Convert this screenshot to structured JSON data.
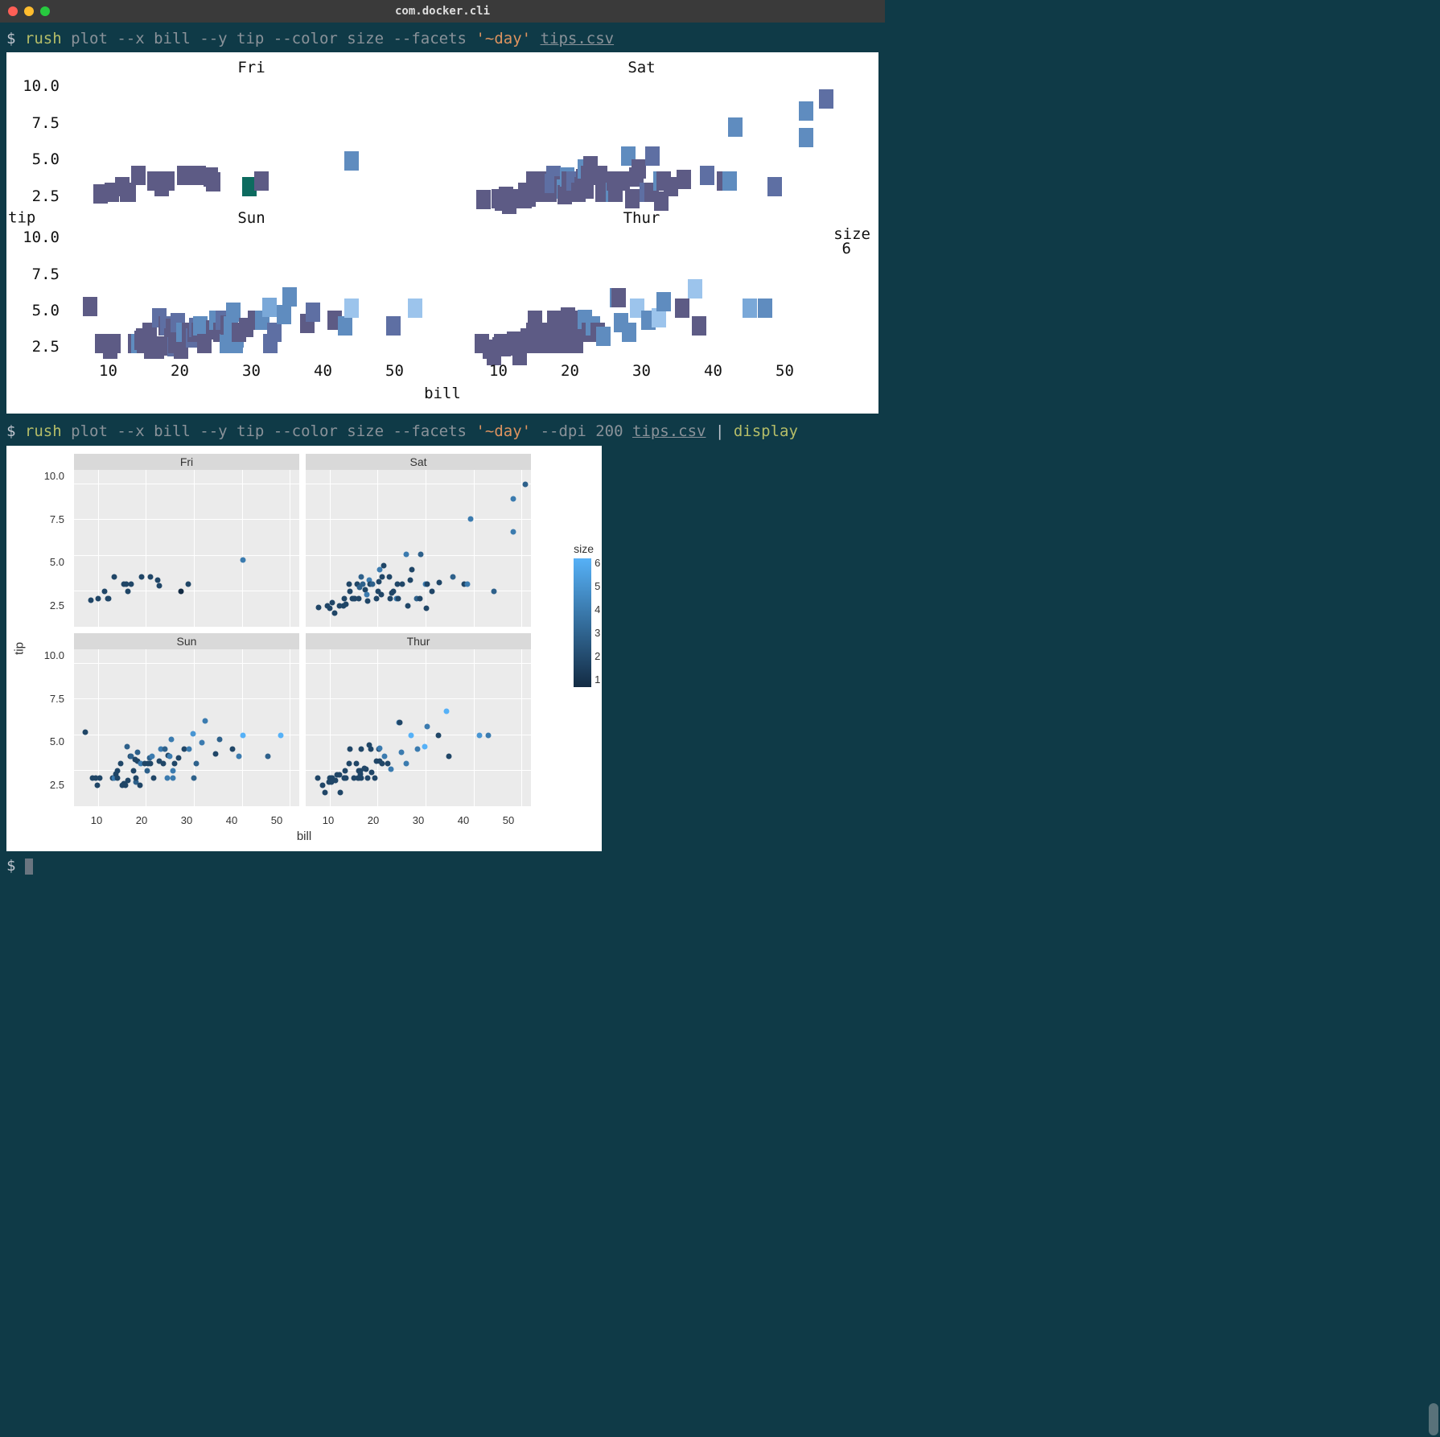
{
  "window": {
    "title": "com.docker.cli"
  },
  "cmd1": {
    "prompt": "$",
    "cmd": "rush",
    "args": "plot --x bill --y tip --color size --facets",
    "str": "'~day'",
    "file": "tips.csv"
  },
  "cmd2": {
    "prompt": "$",
    "cmd": "rush",
    "args": "plot --x bill --y tip --color size --facets",
    "str": "'~day'",
    "args2": "--dpi 200",
    "file": "tips.csv",
    "pipe": "|",
    "display": "display"
  },
  "cmd3": {
    "prompt": "$"
  },
  "ascii_plot": {
    "y_title": "tip",
    "x_title": "bill",
    "legend_title": "size",
    "legend_value": "6",
    "y_ticks_top": [
      "10.0",
      "7.5",
      "5.0",
      "2.5"
    ],
    "y_ticks_bot": [
      "10.0",
      "7.5",
      "5.0",
      "2.5"
    ],
    "x_ticks": [
      "10",
      "20",
      "30",
      "40",
      "50"
    ],
    "facets": [
      "Fri",
      "Sat",
      "Sun",
      "Thur"
    ]
  },
  "chart_data": [
    {
      "type": "scatter",
      "title": "Fri",
      "xlabel": "bill",
      "ylabel": "tip",
      "xlim": [
        5,
        52
      ],
      "ylim": [
        0,
        11
      ],
      "color_var": "size",
      "series": [
        {
          "x": 8.6,
          "y": 1.9,
          "size": 2
        },
        {
          "x": 10.1,
          "y": 2.0,
          "size": 2
        },
        {
          "x": 11.4,
          "y": 2.5,
          "size": 2
        },
        {
          "x": 12.0,
          "y": 2.0,
          "size": 2
        },
        {
          "x": 12.2,
          "y": 2.0,
          "size": 2
        },
        {
          "x": 13.4,
          "y": 3.5,
          "size": 2
        },
        {
          "x": 15.4,
          "y": 3.0,
          "size": 2
        },
        {
          "x": 15.9,
          "y": 3.0,
          "size": 2
        },
        {
          "x": 16.3,
          "y": 2.5,
          "size": 2
        },
        {
          "x": 17.0,
          "y": 3.0,
          "size": 2
        },
        {
          "x": 19.1,
          "y": 3.5,
          "size": 2
        },
        {
          "x": 21.0,
          "y": 3.5,
          "size": 2
        },
        {
          "x": 22.5,
          "y": 3.3,
          "size": 2
        },
        {
          "x": 22.8,
          "y": 2.9,
          "size": 2
        },
        {
          "x": 27.3,
          "y": 2.5,
          "size": 1
        },
        {
          "x": 28.9,
          "y": 3.0,
          "size": 2
        },
        {
          "x": 40.2,
          "y": 4.7,
          "size": 4
        }
      ]
    },
    {
      "type": "scatter",
      "title": "Sat",
      "xlabel": "bill",
      "ylabel": "tip",
      "xlim": [
        5,
        52
      ],
      "ylim": [
        0,
        11
      ],
      "color_var": "size",
      "series": [
        {
          "x": 7.7,
          "y": 1.4,
          "size": 2
        },
        {
          "x": 9.6,
          "y": 1.5,
          "size": 2
        },
        {
          "x": 10.1,
          "y": 1.3,
          "size": 2
        },
        {
          "x": 10.6,
          "y": 1.7,
          "size": 2
        },
        {
          "x": 11.0,
          "y": 1.0,
          "size": 2
        },
        {
          "x": 12.0,
          "y": 1.5,
          "size": 2
        },
        {
          "x": 12.9,
          "y": 1.5,
          "size": 2
        },
        {
          "x": 13.0,
          "y": 2.0,
          "size": 2
        },
        {
          "x": 13.4,
          "y": 1.6,
          "size": 2
        },
        {
          "x": 14.0,
          "y": 3.0,
          "size": 2
        },
        {
          "x": 14.3,
          "y": 2.5,
          "size": 2
        },
        {
          "x": 14.8,
          "y": 2.0,
          "size": 2
        },
        {
          "x": 15.0,
          "y": 2.0,
          "size": 2
        },
        {
          "x": 15.3,
          "y": 2.0,
          "size": 2
        },
        {
          "x": 15.7,
          "y": 3.0,
          "size": 2
        },
        {
          "x": 16.0,
          "y": 2.0,
          "size": 2
        },
        {
          "x": 16.3,
          "y": 2.8,
          "size": 3
        },
        {
          "x": 16.5,
          "y": 3.5,
          "size": 3
        },
        {
          "x": 17.0,
          "y": 3.0,
          "size": 3
        },
        {
          "x": 17.5,
          "y": 2.6,
          "size": 2
        },
        {
          "x": 17.8,
          "y": 2.3,
          "size": 4
        },
        {
          "x": 17.9,
          "y": 1.8,
          "size": 2
        },
        {
          "x": 18.2,
          "y": 3.3,
          "size": 4
        },
        {
          "x": 18.4,
          "y": 3.0,
          "size": 2
        },
        {
          "x": 19.0,
          "y": 3.0,
          "size": 3
        },
        {
          "x": 19.7,
          "y": 2.0,
          "size": 2
        },
        {
          "x": 20.1,
          "y": 2.5,
          "size": 2
        },
        {
          "x": 20.3,
          "y": 3.2,
          "size": 2
        },
        {
          "x": 20.5,
          "y": 4.0,
          "size": 4
        },
        {
          "x": 20.7,
          "y": 2.3,
          "size": 2
        },
        {
          "x": 20.9,
          "y": 3.5,
          "size": 2
        },
        {
          "x": 21.2,
          "y": 4.3,
          "size": 2
        },
        {
          "x": 22.4,
          "y": 3.5,
          "size": 2
        },
        {
          "x": 22.7,
          "y": 2.0,
          "size": 2
        },
        {
          "x": 23.0,
          "y": 2.4,
          "size": 2
        },
        {
          "x": 23.3,
          "y": 2.5,
          "size": 2
        },
        {
          "x": 24.0,
          "y": 2.0,
          "size": 4
        },
        {
          "x": 24.1,
          "y": 3.0,
          "size": 2
        },
        {
          "x": 24.3,
          "y": 2.0,
          "size": 2
        },
        {
          "x": 25.2,
          "y": 3.0,
          "size": 2
        },
        {
          "x": 25.9,
          "y": 5.1,
          "size": 4
        },
        {
          "x": 26.4,
          "y": 1.5,
          "size": 2
        },
        {
          "x": 26.9,
          "y": 3.3,
          "size": 2
        },
        {
          "x": 27.2,
          "y": 4.0,
          "size": 2
        },
        {
          "x": 28.2,
          "y": 2.0,
          "size": 3
        },
        {
          "x": 28.9,
          "y": 2.0,
          "size": 2
        },
        {
          "x": 29.0,
          "y": 5.1,
          "size": 3
        },
        {
          "x": 30.0,
          "y": 3.0,
          "size": 4
        },
        {
          "x": 30.1,
          "y": 1.3,
          "size": 2
        },
        {
          "x": 30.4,
          "y": 3.0,
          "size": 2
        },
        {
          "x": 31.3,
          "y": 2.5,
          "size": 2
        },
        {
          "x": 32.9,
          "y": 3.1,
          "size": 2
        },
        {
          "x": 35.8,
          "y": 3.5,
          "size": 3
        },
        {
          "x": 38.0,
          "y": 3.0,
          "size": 2
        },
        {
          "x": 38.7,
          "y": 3.0,
          "size": 4
        },
        {
          "x": 39.4,
          "y": 7.6,
          "size": 4
        },
        {
          "x": 44.3,
          "y": 2.5,
          "size": 3
        },
        {
          "x": 48.3,
          "y": 6.7,
          "size": 4
        },
        {
          "x": 48.3,
          "y": 9.0,
          "size": 4
        },
        {
          "x": 50.8,
          "y": 10.0,
          "size": 3
        }
      ]
    },
    {
      "type": "scatter",
      "title": "Sun",
      "xlabel": "bill",
      "ylabel": "tip",
      "xlim": [
        5,
        52
      ],
      "ylim": [
        0,
        11
      ],
      "color_var": "size",
      "series": [
        {
          "x": 7.3,
          "y": 5.2,
          "size": 2
        },
        {
          "x": 8.8,
          "y": 2.0,
          "size": 2
        },
        {
          "x": 9.6,
          "y": 2.0,
          "size": 2
        },
        {
          "x": 9.9,
          "y": 1.5,
          "size": 2
        },
        {
          "x": 10.3,
          "y": 2.0,
          "size": 2
        },
        {
          "x": 13.0,
          "y": 2.0,
          "size": 2
        },
        {
          "x": 13.4,
          "y": 2.0,
          "size": 4
        },
        {
          "x": 13.8,
          "y": 2.3,
          "size": 2
        },
        {
          "x": 14.0,
          "y": 2.5,
          "size": 2
        },
        {
          "x": 14.1,
          "y": 2.0,
          "size": 2
        },
        {
          "x": 14.8,
          "y": 3.0,
          "size": 2
        },
        {
          "x": 15.0,
          "y": 1.5,
          "size": 2
        },
        {
          "x": 15.4,
          "y": 1.6,
          "size": 2
        },
        {
          "x": 15.7,
          "y": 1.5,
          "size": 2
        },
        {
          "x": 16.0,
          "y": 4.2,
          "size": 3
        },
        {
          "x": 16.3,
          "y": 1.8,
          "size": 2
        },
        {
          "x": 16.8,
          "y": 3.5,
          "size": 2
        },
        {
          "x": 17.0,
          "y": 3.5,
          "size": 3
        },
        {
          "x": 17.5,
          "y": 2.5,
          "size": 2
        },
        {
          "x": 17.7,
          "y": 3.3,
          "size": 2
        },
        {
          "x": 17.9,
          "y": 1.7,
          "size": 3
        },
        {
          "x": 18.0,
          "y": 2.0,
          "size": 2
        },
        {
          "x": 18.2,
          "y": 3.2,
          "size": 2
        },
        {
          "x": 18.3,
          "y": 3.8,
          "size": 3
        },
        {
          "x": 18.7,
          "y": 1.5,
          "size": 2
        },
        {
          "x": 19.0,
          "y": 3.0,
          "size": 4
        },
        {
          "x": 19.8,
          "y": 3.0,
          "size": 2
        },
        {
          "x": 20.3,
          "y": 2.5,
          "size": 3
        },
        {
          "x": 20.5,
          "y": 3.0,
          "size": 2
        },
        {
          "x": 20.7,
          "y": 3.4,
          "size": 3
        },
        {
          "x": 21.0,
          "y": 3.0,
          "size": 2
        },
        {
          "x": 21.2,
          "y": 3.5,
          "size": 4
        },
        {
          "x": 21.7,
          "y": 2.0,
          "size": 2
        },
        {
          "x": 22.8,
          "y": 3.2,
          "size": 2
        },
        {
          "x": 23.2,
          "y": 4.0,
          "size": 4
        },
        {
          "x": 23.7,
          "y": 3.0,
          "size": 2
        },
        {
          "x": 24.0,
          "y": 4.0,
          "size": 3
        },
        {
          "x": 24.5,
          "y": 2.0,
          "size": 4
        },
        {
          "x": 24.6,
          "y": 3.6,
          "size": 2
        },
        {
          "x": 25.0,
          "y": 3.5,
          "size": 4
        },
        {
          "x": 25.3,
          "y": 4.7,
          "size": 4
        },
        {
          "x": 25.6,
          "y": 2.0,
          "size": 4
        },
        {
          "x": 25.7,
          "y": 2.5,
          "size": 4
        },
        {
          "x": 26.0,
          "y": 3.0,
          "size": 2
        },
        {
          "x": 26.9,
          "y": 3.4,
          "size": 2
        },
        {
          "x": 28.0,
          "y": 4.0,
          "size": 2
        },
        {
          "x": 29.0,
          "y": 4.0,
          "size": 4
        },
        {
          "x": 29.9,
          "y": 5.1,
          "size": 5
        },
        {
          "x": 30.0,
          "y": 2.0,
          "size": 3
        },
        {
          "x": 30.5,
          "y": 3.0,
          "size": 3
        },
        {
          "x": 31.7,
          "y": 4.5,
          "size": 4
        },
        {
          "x": 32.4,
          "y": 6.0,
          "size": 4
        },
        {
          "x": 34.6,
          "y": 3.7,
          "size": 2
        },
        {
          "x": 35.3,
          "y": 4.7,
          "size": 3
        },
        {
          "x": 38.1,
          "y": 4.0,
          "size": 2
        },
        {
          "x": 39.4,
          "y": 3.5,
          "size": 4
        },
        {
          "x": 40.2,
          "y": 5.0,
          "size": 6
        },
        {
          "x": 45.4,
          "y": 3.5,
          "size": 3
        },
        {
          "x": 48.2,
          "y": 5.0,
          "size": 6
        }
      ]
    },
    {
      "type": "scatter",
      "title": "Thur",
      "xlabel": "bill",
      "ylabel": "tip",
      "xlim": [
        5,
        52
      ],
      "ylim": [
        0,
        11
      ],
      "color_var": "size",
      "series": [
        {
          "x": 7.5,
          "y": 2.0,
          "size": 2
        },
        {
          "x": 8.5,
          "y": 1.5,
          "size": 2
        },
        {
          "x": 9.0,
          "y": 1.0,
          "size": 2
        },
        {
          "x": 9.8,
          "y": 1.7,
          "size": 2
        },
        {
          "x": 10.0,
          "y": 2.0,
          "size": 2
        },
        {
          "x": 10.3,
          "y": 1.7,
          "size": 2
        },
        {
          "x": 10.3,
          "y": 2.0,
          "size": 2
        },
        {
          "x": 10.5,
          "y": 2.0,
          "size": 2
        },
        {
          "x": 11.2,
          "y": 1.8,
          "size": 2
        },
        {
          "x": 11.6,
          "y": 2.2,
          "size": 2
        },
        {
          "x": 12.0,
          "y": 2.2,
          "size": 2
        },
        {
          "x": 12.3,
          "y": 1.0,
          "size": 2
        },
        {
          "x": 13.0,
          "y": 2.0,
          "size": 2
        },
        {
          "x": 13.1,
          "y": 2.0,
          "size": 2
        },
        {
          "x": 13.3,
          "y": 2.5,
          "size": 2
        },
        {
          "x": 13.4,
          "y": 2.0,
          "size": 2
        },
        {
          "x": 14.0,
          "y": 3.0,
          "size": 2
        },
        {
          "x": 14.2,
          "y": 4.0,
          "size": 2
        },
        {
          "x": 15.0,
          "y": 2.0,
          "size": 2
        },
        {
          "x": 15.5,
          "y": 3.0,
          "size": 2
        },
        {
          "x": 15.9,
          "y": 2.0,
          "size": 2
        },
        {
          "x": 16.0,
          "y": 2.5,
          "size": 2
        },
        {
          "x": 16.0,
          "y": 2.0,
          "size": 2
        },
        {
          "x": 16.4,
          "y": 2.3,
          "size": 2
        },
        {
          "x": 16.4,
          "y": 2.5,
          "size": 2
        },
        {
          "x": 16.5,
          "y": 2.0,
          "size": 2
        },
        {
          "x": 16.6,
          "y": 4.0,
          "size": 2
        },
        {
          "x": 17.3,
          "y": 2.7,
          "size": 2
        },
        {
          "x": 17.6,
          "y": 2.6,
          "size": 2
        },
        {
          "x": 18.0,
          "y": 2.0,
          "size": 2
        },
        {
          "x": 18.3,
          "y": 4.3,
          "size": 2
        },
        {
          "x": 18.6,
          "y": 4.0,
          "size": 2
        },
        {
          "x": 18.8,
          "y": 2.4,
          "size": 2
        },
        {
          "x": 19.4,
          "y": 2.0,
          "size": 2
        },
        {
          "x": 19.8,
          "y": 3.2,
          "size": 2
        },
        {
          "x": 20.3,
          "y": 4.0,
          "size": 2
        },
        {
          "x": 20.5,
          "y": 3.2,
          "size": 2
        },
        {
          "x": 20.5,
          "y": 4.1,
          "size": 4
        },
        {
          "x": 21.0,
          "y": 3.0,
          "size": 2
        },
        {
          "x": 21.5,
          "y": 3.5,
          "size": 4
        },
        {
          "x": 22.1,
          "y": 3.0,
          "size": 2
        },
        {
          "x": 22.8,
          "y": 2.6,
          "size": 4
        },
        {
          "x": 24.5,
          "y": 5.9,
          "size": 4
        },
        {
          "x": 24.7,
          "y": 5.9,
          "size": 2
        },
        {
          "x": 25.0,
          "y": 3.8,
          "size": 4
        },
        {
          "x": 26.0,
          "y": 3.0,
          "size": 4
        },
        {
          "x": 27.0,
          "y": 5.0,
          "size": 6
        },
        {
          "x": 28.4,
          "y": 4.0,
          "size": 4
        },
        {
          "x": 29.8,
          "y": 4.2,
          "size": 6
        },
        {
          "x": 30.4,
          "y": 5.6,
          "size": 4
        },
        {
          "x": 32.7,
          "y": 5.0,
          "size": 2
        },
        {
          "x": 34.3,
          "y": 6.7,
          "size": 6
        },
        {
          "x": 34.8,
          "y": 3.5,
          "size": 2
        },
        {
          "x": 41.2,
          "y": 5.0,
          "size": 5
        },
        {
          "x": 43.1,
          "y": 5.0,
          "size": 4
        }
      ]
    }
  ],
  "ggplot": {
    "ylab": "tip",
    "xlab": "bill",
    "legend_title": "size",
    "y_ticks": [
      "10.0",
      "7.5",
      "5.0",
      "2.5"
    ],
    "x_ticks": [
      "10",
      "20",
      "30",
      "40",
      "50"
    ],
    "legend_ticks": [
      "1",
      "2",
      "3",
      "4",
      "5",
      "6"
    ],
    "facets": [
      "Fri",
      "Sat",
      "Sun",
      "Thur"
    ]
  }
}
